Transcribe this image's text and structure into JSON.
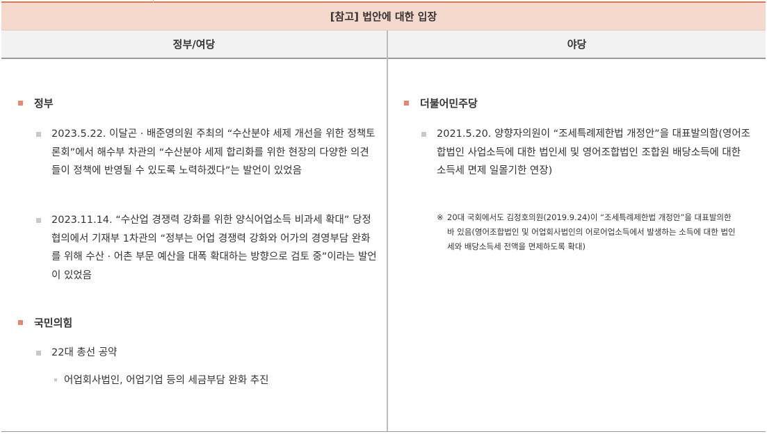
{
  "title": "[참고] 법안에 대한 입장",
  "columns": {
    "left": "정부/여당",
    "right": "야당"
  },
  "left": {
    "sections": [
      {
        "heading": "정부",
        "items": [
          "2023.5.22. 이달곤 · 배준영의원 주최의 “수산분야 세제 개선을 위한 정책토론회”에서 해수부 차관의 “수산분야 세제 합리화를 위한 현장의 다양한 의견들이 정책에 반영될 수 있도록 노력하겠다”는 발언이 있었음",
          "2023.11.14. “수산업 경쟁력 강화를 위한 양식어업소득 비과세 확대” 당정협의에서 기재부 1차관의 “정부는 어업 경쟁력 강화와 어가의 경영부담 완화를 위해 수산 · 어촌 부문 예산을 대폭 확대하는 방향으로 검토 중”이라는 발언이 있었음"
        ]
      },
      {
        "heading": "국민의힘",
        "items": [
          "22대 총선 공약"
        ],
        "subitems": [
          "어업회사법인, 어업기업 등의 세금부담 완화 추진"
        ]
      }
    ]
  },
  "right": {
    "sections": [
      {
        "heading": "더불어민주당",
        "items": [
          "2021.5.20. 양향자의원이 “조세특례제한법 개정안”을 대표발의함(영어조합법인 사업소득에 대한 법인세 및 영어조합법인 조합원 배당소득에 대한 소득세 면제 일몰기한 연장)"
        ],
        "note_mark": "※",
        "note": "20대 국회에서도 김정호의원(2019.9.24)이 “조세특례제한법 개정안”을 대표발의한 바 있음(영어조합법인 및 어업회사법인의 어로어업소득에서 발생하는 소득에 대한 법인세와 배당소득세 전액을 면제하도록 확대)"
      }
    ]
  }
}
